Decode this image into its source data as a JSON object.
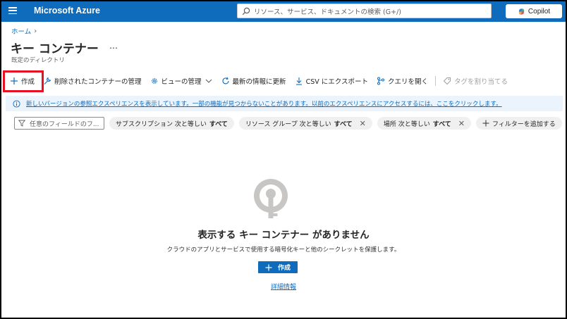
{
  "topbar": {
    "brand": "Microsoft Azure",
    "search_placeholder": "リソース、サービス、ドキュメントの検索 (G+/)",
    "copilot_label": "Copilot",
    "bg_color": "#0f6cbd"
  },
  "breadcrumb": {
    "home": "ホーム"
  },
  "page": {
    "title": "キー コンテナー",
    "more": "…",
    "subtitle": "既定のディレクトリ"
  },
  "toolbar": {
    "create": "作成",
    "manage_deleted": "削除されたコンテナーの管理",
    "manage_view": "ビューの管理",
    "refresh": "最新の情報に更新",
    "export_csv": "CSV にエクスポート",
    "open_query": "クエリを開く",
    "assign_tags": "タグを割り当てる"
  },
  "banner": {
    "text": "新しいバージョンの参照エクスペリエンスを表示しています。一部の機能が見つからないことがあります。以前のエクスペリエンスにアクセスするには、ここをクリックします。"
  },
  "filters": {
    "placeholder": "任意のフィールドのフ...",
    "subscription_label": "サブスクリプション 次と等しい",
    "subscription_value": "すべて",
    "resource_group_label": "リソース グループ 次と等しい",
    "resource_group_value": "すべて",
    "location_label": "場所 次と等しい",
    "location_value": "すべて",
    "add_filter": "フィルターを追加する"
  },
  "empty_state": {
    "title": "表示する キー コンテナー がありません",
    "description": "クラウドのアプリとサービスで使用する暗号化キーと他のシークレットを保護します。",
    "create_button": "作成",
    "learn_more": "詳細情報"
  },
  "colors": {
    "accent": "#0f6cbd",
    "highlight": "#e81123",
    "banner_bg": "#ebf3fc"
  }
}
